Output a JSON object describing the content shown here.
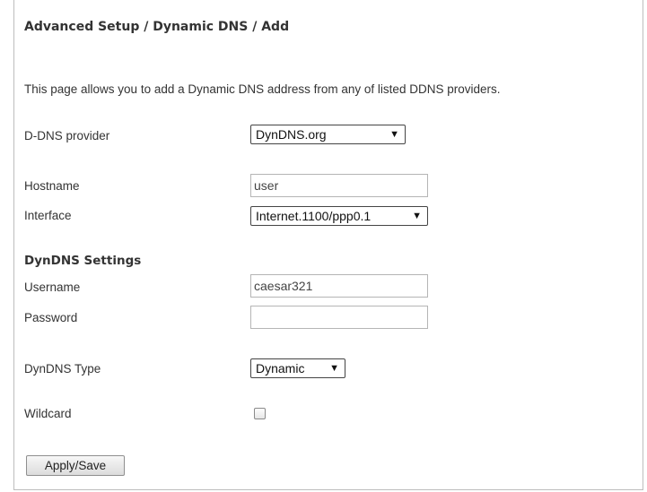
{
  "header": {
    "breadcrumb": "Advanced Setup / Dynamic DNS / Add",
    "description": "This page allows you to add a Dynamic DNS address from any of listed DDNS providers."
  },
  "form": {
    "provider_label": "D-DNS provider",
    "provider_value": "DynDNS.org",
    "hostname_label": "Hostname",
    "hostname_value": "user",
    "interface_label": "Interface",
    "interface_value": "Internet.1100/ppp0.1",
    "section_title": "DynDNS Settings",
    "username_label": "Username",
    "username_value": "caesar321",
    "password_label": "Password",
    "password_value": "",
    "type_label": "DynDNS Type",
    "type_value": "Dynamic",
    "wildcard_label": "Wildcard",
    "wildcard_checked": false,
    "apply_label": "Apply/Save"
  },
  "icons": {
    "dropdown_arrow": "▼"
  }
}
